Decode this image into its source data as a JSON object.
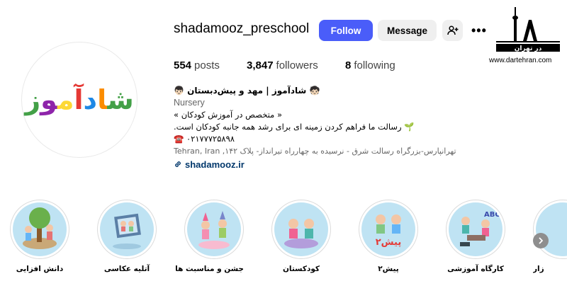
{
  "profile": {
    "username": "shadamooz_preschool",
    "logo_text": "شادآموز",
    "follow_label": "Follow",
    "message_label": "Message",
    "more_label": "•••"
  },
  "stats": {
    "posts_count": "554",
    "posts_label": "posts",
    "followers_count": "3,847",
    "followers_label": "followers",
    "following_count": "8",
    "following_label": "following"
  },
  "bio": {
    "title": "🧒🏻 شادآموز | مهد و پیش‌دبستان 👦🏻",
    "category": "Nursery",
    "line1": "« متخصص در آموزش کودکان »",
    "line2": "🌱 رسالت ما فراهم کردن زمینه ای برای رشد همه جانبه کودکان است.",
    "phone": "☎️ ۰۲۱۷۷۷۲۵۸۹۸",
    "address": "Tehran, Iran ,تهرانپارس-بزرگراه رسالت شرق - نرسیده به چهارراه تیرانداز- پلاک ۱۴۲",
    "link": "shadamooz.ir"
  },
  "watermark": {
    "text": "در تهران",
    "url": "www.dartehran.com"
  },
  "highlights": [
    {
      "label": "دانش افزایی"
    },
    {
      "label": "آتلیه عکاسی"
    },
    {
      "label": "جشن و مناسبت ها"
    },
    {
      "label": "کودکستان"
    },
    {
      "label": "پیش۲"
    },
    {
      "label": "کارگاه آموزشی"
    },
    {
      "label": "زار"
    }
  ],
  "colors": {
    "follow_bg": "#4a5df9",
    "secondary_bg": "#efefef",
    "highlight_bg": "#bfe3f3",
    "logo_colors": [
      "#e53935",
      "#fb8c00",
      "#fdd835",
      "#43a047",
      "#1e88e5",
      "#8e24aa"
    ]
  }
}
